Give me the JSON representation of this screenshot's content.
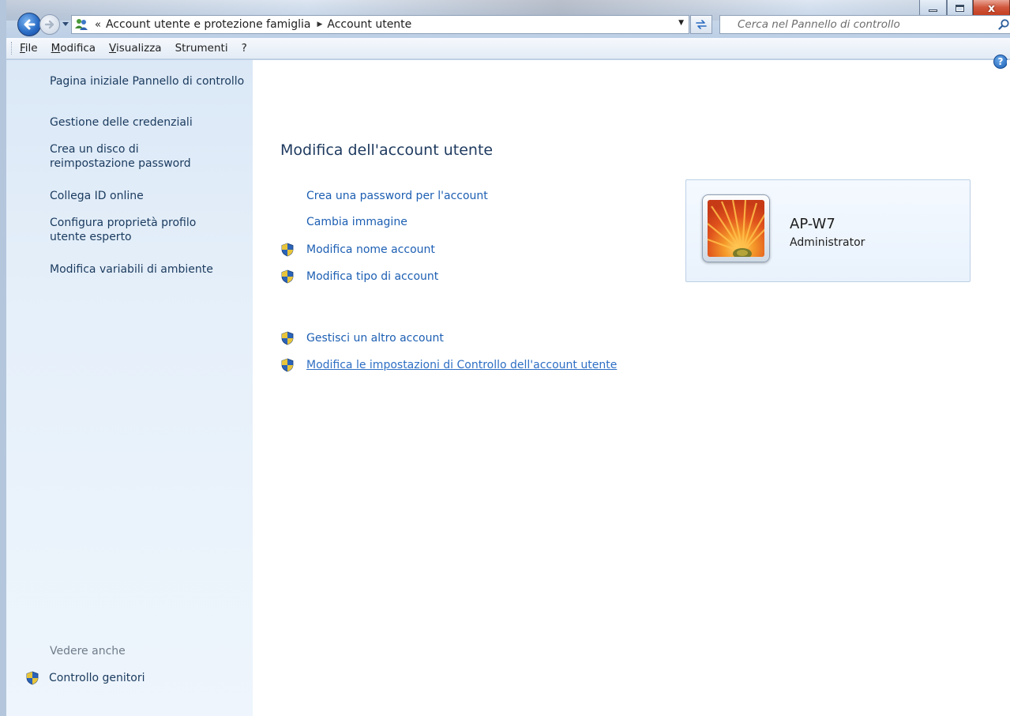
{
  "window": {
    "breadcrumb": {
      "overflow": "«",
      "items": [
        "Account utente e protezione famiglia",
        "Account utente"
      ]
    },
    "search": {
      "placeholder": "Cerca nel Pannello di controllo"
    },
    "close_glyph": "x"
  },
  "menu": {
    "items": [
      "File",
      "Modifica",
      "Visualizza",
      "Strumenti",
      "?"
    ]
  },
  "sidebar": {
    "links": [
      "Pagina iniziale Pannello di controllo",
      "Gestione delle credenziali",
      "Crea un disco di reimpostazione password",
      "Collega ID online",
      "Configura proprietà profilo utente esperto",
      "Modifica variabili di ambiente"
    ],
    "see_also_heading": "Vedere anche",
    "see_also_links": [
      "Controllo genitori"
    ]
  },
  "main": {
    "title": "Modifica dell'account utente",
    "tasks": [
      {
        "label": "Crea una password per l'account",
        "icon": "none"
      },
      {
        "label": "Cambia immagine",
        "icon": "none"
      },
      {
        "label": "Modifica nome account",
        "icon": "uac-shield-icon"
      },
      {
        "label": "Modifica tipo di account",
        "icon": "uac-shield-icon"
      },
      {
        "label": "Gestisci un altro account",
        "icon": "uac-shield-icon"
      },
      {
        "label": "Modifica le impostazioni di Controllo dell'account utente",
        "icon": "uac-shield-icon"
      }
    ],
    "help_glyph": "?"
  },
  "user": {
    "name": "AP-W7",
    "role": "Administrator",
    "picture": "flower-picture"
  },
  "colors": {
    "link": "#1d5fb3",
    "sidebar_bg": "#dbe8f6",
    "title_text": "#1e3a5f"
  }
}
